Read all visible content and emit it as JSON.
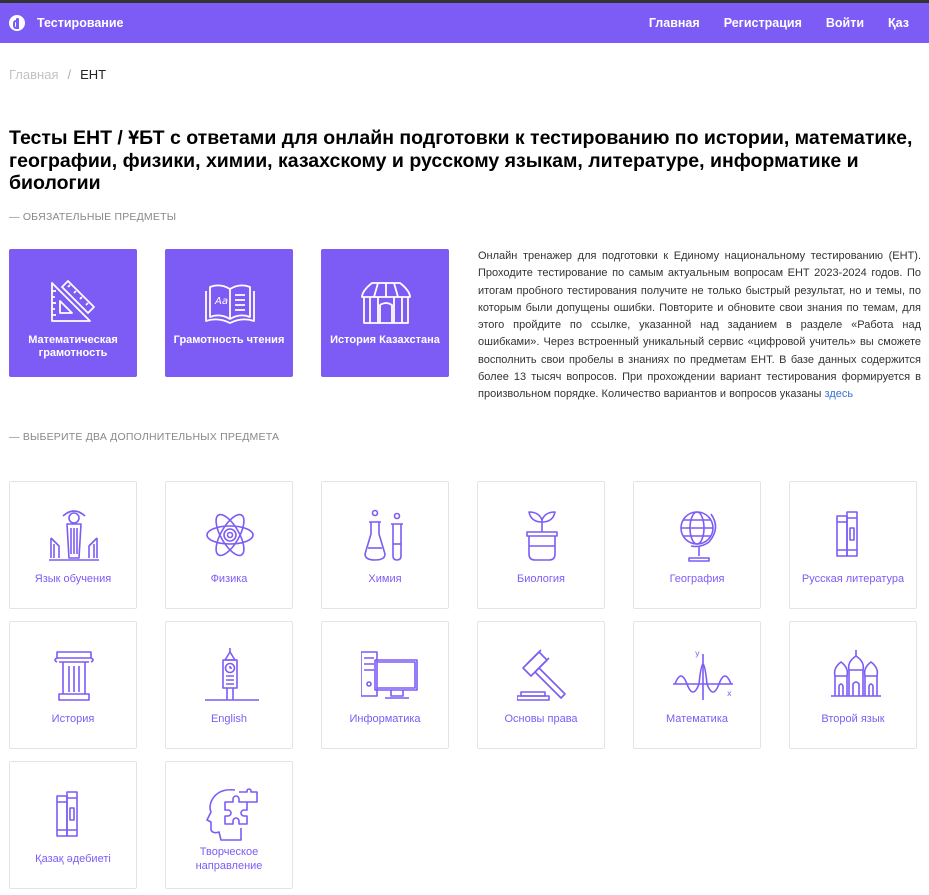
{
  "header": {
    "brand": "Тестирование",
    "nav": [
      "Главная",
      "Регистрация",
      "Войти",
      "Қаз"
    ]
  },
  "breadcrumb": {
    "home": "Главная",
    "sep": "/",
    "current": "ЕНТ"
  },
  "page_title": "Тесты ЕНТ / ҰБТ с ответами для онлайн подготовки к тестированию по истории, математике, географии, физики, химии, казахскому и русскому языкам, литературе, информатике и биологии",
  "required_section": "— ОБЯЗАТЕЛЬНЫЕ ПРЕДМЕТЫ",
  "required": [
    {
      "label": "Математическая грамотность",
      "icon": "ruler-triangle-icon"
    },
    {
      "label": "Грамотность чтения",
      "icon": "open-book-icon"
    },
    {
      "label": "История Казахстана",
      "icon": "yurt-icon"
    }
  ],
  "description": {
    "text": "Онлайн тренажер для подготовки к Единому национальному тестированию (ЕНТ). Проходите тестирование по самым актуальным вопросам ЕНТ 2023-2024 годов. По итогам пробного тестирования получите не только быстрый результат, но и темы, по которым были допущены ошибки. Повторите и обновите свои знания по темам, для этого пройдите по ссылке, указанной над заданием в разделе «Работа над ошибками». Через встроенный уникальный сервис «цифровой учитель» вы сможете восполнить свои пробелы в знаниях по предметам ЕНТ. В базе данных содержится более 13 тысяч вопросов. При прохождении вариант тестирования формируется в произвольном порядке. Количество вариантов и вопросов указаны ",
    "link": "здесь"
  },
  "optional_section": "— ВЫБЕРИТЕ ДВА ДОПОЛНИТЕЛЬНЫХ ПРЕДМЕТА",
  "optional": [
    {
      "label": "Язык обучения",
      "icon": "monument-icon"
    },
    {
      "label": "Физика",
      "icon": "atom-icon"
    },
    {
      "label": "Химия",
      "icon": "test-tubes-icon"
    },
    {
      "label": "Биология",
      "icon": "plant-pot-icon"
    },
    {
      "label": "География",
      "icon": "globe-icon"
    },
    {
      "label": "Русская литература",
      "icon": "books-icon"
    },
    {
      "label": "История",
      "icon": "column-icon"
    },
    {
      "label": "English",
      "icon": "big-ben-icon"
    },
    {
      "label": "Информатика",
      "icon": "computer-icon"
    },
    {
      "label": "Основы права",
      "icon": "gavel-icon"
    },
    {
      "label": "Математика",
      "icon": "graph-icon"
    },
    {
      "label": "Второй язык",
      "icon": "cathedral-icon"
    },
    {
      "label": "Қазақ әдебиеті",
      "icon": "books-icon"
    },
    {
      "label": "Творческое направление",
      "icon": "head-puzzle-icon"
    }
  ],
  "colors": {
    "accent": "#7c5cf5",
    "card_border": "#e4e4e4",
    "link": "#3b6fcf"
  }
}
